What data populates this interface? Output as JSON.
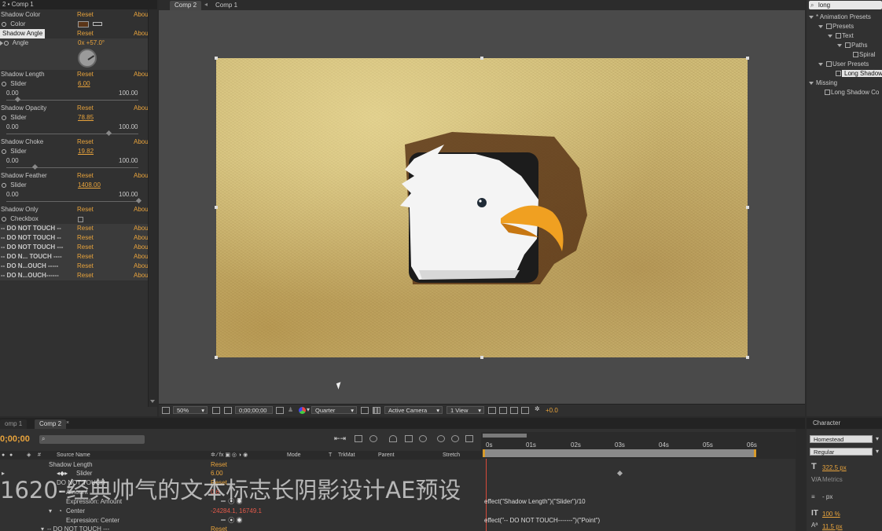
{
  "effect_controls": {
    "title": "2 • Comp 1",
    "rows": [
      {
        "label": "Shadow Color",
        "reset": "Reset",
        "about": "Abou"
      },
      {
        "label": "Color"
      },
      {
        "label": "Shadow Angle",
        "reset": "Reset",
        "about": "Abou"
      },
      {
        "label": "Angle",
        "value": "0x +57.0°"
      },
      {
        "label": "Shadow Length",
        "reset": "Reset",
        "about": "Abou"
      },
      {
        "label": "Slider",
        "value": "6.00",
        "min": "0.00",
        "max": "100.00"
      },
      {
        "label": "Shadow Opacity",
        "reset": "Reset",
        "about": "Abou"
      },
      {
        "label": "Slider",
        "value": "78.85",
        "min": "0.00",
        "max": "100.00"
      },
      {
        "label": "Shadow Choke",
        "reset": "Reset",
        "about": "Abou"
      },
      {
        "label": "Slider",
        "value": "19.82",
        "min": "0.00",
        "max": "100.00"
      },
      {
        "label": "Shadow Feather",
        "reset": "Reset",
        "about": "Abou"
      },
      {
        "label": "Slider",
        "value": "1408.00",
        "min": "0.00",
        "max": "100.00"
      },
      {
        "label": "Shadow Only",
        "reset": "Reset",
        "about": "Abou"
      },
      {
        "label": "Checkbox"
      }
    ],
    "donot": [
      {
        "label": "-- DO NOT TOUCH --",
        "reset": "Reset",
        "about": "Abou"
      },
      {
        "label": "-- DO NOT TOUCH --",
        "reset": "Reset",
        "about": "Abou"
      },
      {
        "label": "-- DO NOT TOUCH ---",
        "reset": "Reset",
        "about": "Abou"
      },
      {
        "label": "-- DO N... TOUCH ----",
        "reset": "Reset",
        "about": "Abou"
      },
      {
        "label": "-- DO N...OUCH -----",
        "reset": "Reset",
        "about": "Abou"
      },
      {
        "label": "-- DO N...OUCH------",
        "reset": "Reset",
        "about": "Abou"
      }
    ]
  },
  "viewer": {
    "tab": "Comp 2",
    "breadcrumb": "Comp 1",
    "zoom": "50%",
    "timecode": "0;00;00;00",
    "resolution": "Quarter",
    "camera": "Active Camera",
    "view": "1 View",
    "exposure": "+0.0"
  },
  "project": {
    "search": "long",
    "tree": [
      {
        "label": "* Animation Presets",
        "indent": 0
      },
      {
        "label": "Presets",
        "indent": 1
      },
      {
        "label": "Text",
        "indent": 2
      },
      {
        "label": "Paths",
        "indent": 3
      },
      {
        "label": "Spiral",
        "indent": 4
      },
      {
        "label": "User Presets",
        "indent": 1
      },
      {
        "label": "Long Shadow",
        "indent": 2,
        "selected": true
      },
      {
        "label": "Missing",
        "indent": 0
      },
      {
        "label": "Long Shadow Co",
        "indent": 2
      }
    ]
  },
  "timeline": {
    "tabs": [
      "omp 1",
      "Comp 2"
    ],
    "timecode": "0;00;00",
    "columns": {
      "source": "Source Name",
      "mode": "Mode",
      "t": "T",
      "trkmat": "TrkMat",
      "parent": "Parent",
      "stretch": "Stretch"
    },
    "ruler": [
      "0s",
      "01s",
      "02s",
      "03s",
      "04s",
      "05s",
      "06s"
    ],
    "layers": [
      {
        "label": "Shadow Length",
        "value": "Reset",
        "indent": 60
      },
      {
        "label": "Slider",
        "value": "6.00",
        "indent": 96
      },
      {
        "label": "DO NOT TOUCH",
        "value": "Reset",
        "indent": 72
      },
      {
        "label": "Amount",
        "value": "0.6",
        "indent": 84
      },
      {
        "label": "Expression: Amount",
        "value": "",
        "indent": 84,
        "expr": "effect(\"Shadow Length\")(\"Slider\")/10"
      },
      {
        "label": "Center",
        "value": "-24284.1, 16749.1",
        "indent": 84
      },
      {
        "label": "Expression: Center",
        "value": "",
        "indent": 84,
        "expr": "effect(\"-- DO NOT TOUCH-------\")(\"Point\")"
      },
      {
        "label": "-- DO NOT TOUCH ---",
        "value": "Reset",
        "indent": 60
      }
    ]
  },
  "character": {
    "title": "Character",
    "font": "Homestead",
    "style": "Regular",
    "size": "322.5 px",
    "metrics": "Metrics",
    "leading_unit": "- px",
    "scale": "100 %",
    "baseline": "11.5 px"
  },
  "overlay": {
    "caption": "1620-经典帅气的文本标志长阴影设计AE预设"
  },
  "colors": {
    "accent": "#e8a33c",
    "shadow_swatch": "#5a3518",
    "canvas": "#d6c27e"
  }
}
